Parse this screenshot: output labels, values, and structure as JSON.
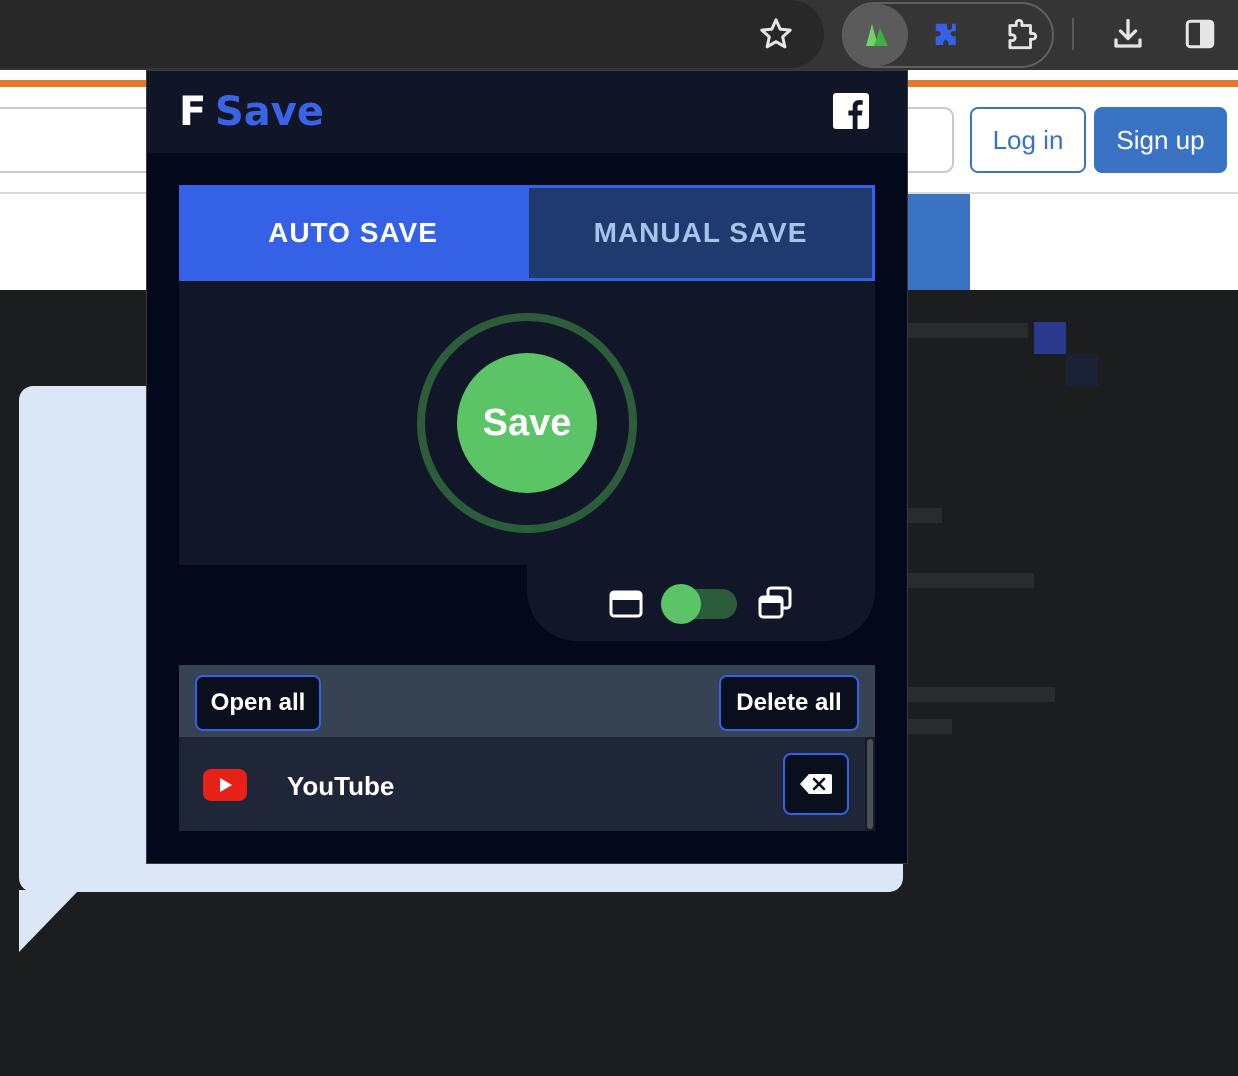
{
  "browser": {
    "toolbar_icons": [
      "star-icon",
      "fsave-extension-icon",
      "puzzle-extensions-icon",
      "extension-box-icon",
      "download-icon",
      "side-panel-icon"
    ]
  },
  "webpage": {
    "login_label": "Log in",
    "signup_label": "Sign up",
    "accent": "#3b73c4"
  },
  "popup": {
    "logo_f": "F",
    "logo_save": "Save",
    "tabs": {
      "auto_label": "AUTO SAVE",
      "manual_label": "MANUAL SAVE",
      "active": "auto"
    },
    "save_button_label": "Save",
    "toggle_on": true,
    "open_all_label": "Open all",
    "delete_all_label": "Delete all",
    "items": [
      {
        "label": "YouTube",
        "icon": "youtube-icon"
      }
    ],
    "colors": {
      "brand_blue": "#3461e6",
      "save_green": "#5bc466",
      "background": "#04081b"
    }
  }
}
